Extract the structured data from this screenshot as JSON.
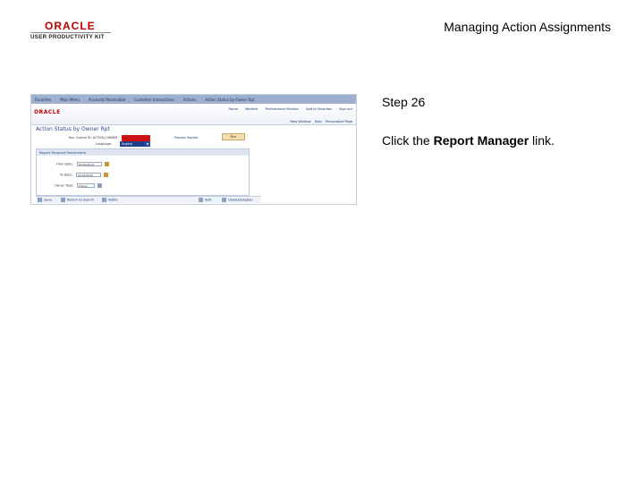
{
  "header": {
    "logo_oracle": "ORACLE",
    "logo_upk": "USER PRODUCTIVITY KIT",
    "doc_title": "Managing Action Assignments"
  },
  "step": {
    "number": "Step 26",
    "instruction_prefix": "Click the ",
    "instruction_bold": "Report Manager",
    "instruction_suffix": " link."
  },
  "screenshot": {
    "menu_items": [
      "Favorites",
      "Main Menu",
      "Accounts Receivable",
      "Customer Interactions",
      "Actions",
      "Action Status by Owner Rpt"
    ],
    "brand": "ORACLE",
    "top_links": [
      "Home",
      "Worklist",
      "Performance Monitor",
      "Add to Favorites",
      "Sign out"
    ],
    "page_links": [
      "New Window",
      "Help",
      "Personalize Page"
    ],
    "page_title": "Action Status by Owner Rpt",
    "run_control_label": "Run Control ID:",
    "run_control_value": "ACTION_OWNER",
    "report_manager_link": "Report Manager",
    "process_monitor_link": "Process Monitor",
    "run_button": "Run",
    "language_label": "Language:",
    "language_value": "English",
    "params_header": "Report Request Parameters",
    "params": [
      {
        "label": "From Date:",
        "value": "01/01/2010"
      },
      {
        "label": "To Date:",
        "value": "01/31/2010"
      },
      {
        "label": "Owner Type:",
        "value": "Owner"
      }
    ],
    "bottom_buttons": [
      "Save",
      "Return to Search",
      "Notify",
      "Add",
      "Update/Display"
    ]
  }
}
